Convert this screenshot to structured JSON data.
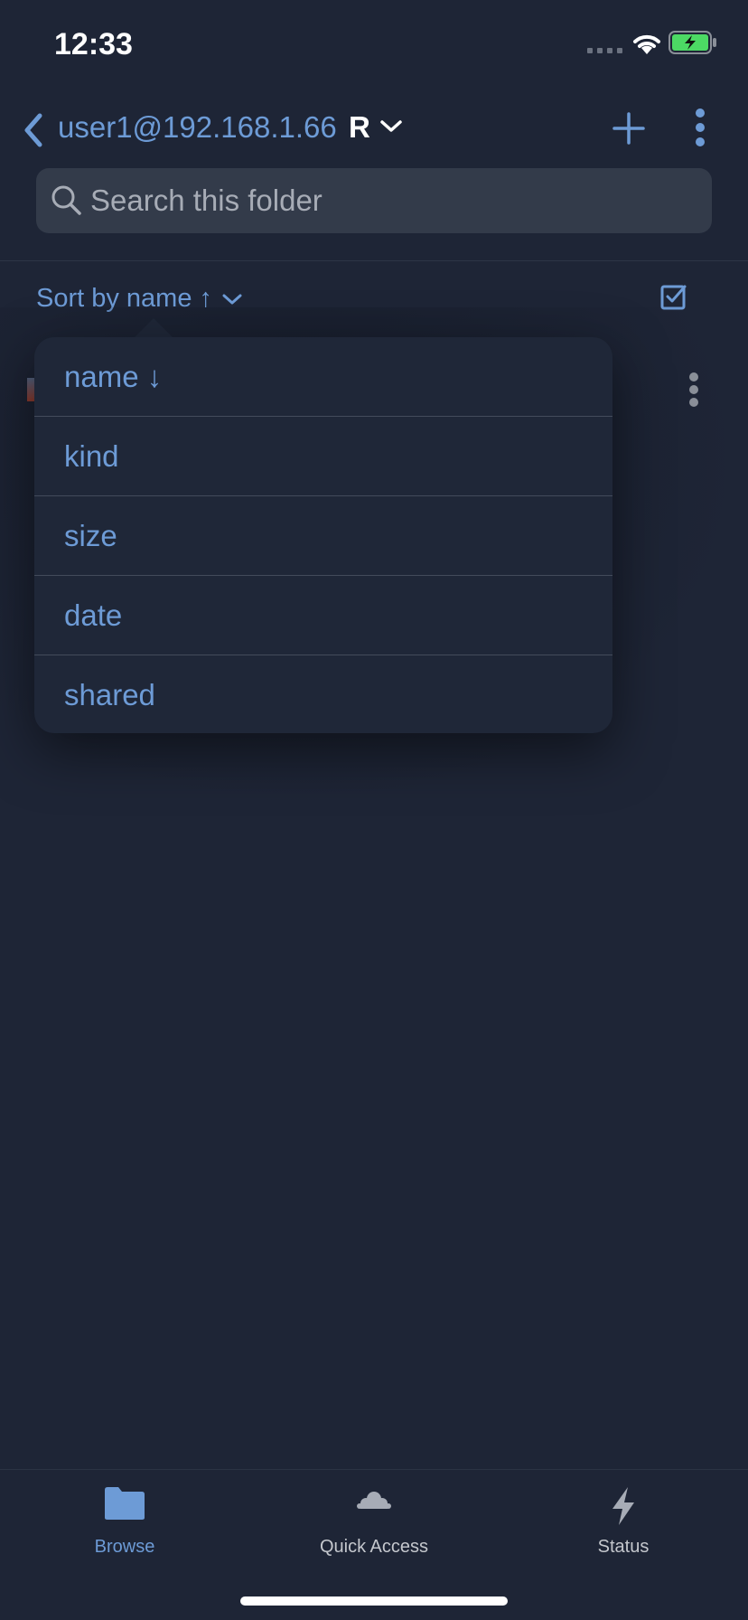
{
  "status_bar": {
    "time": "12:33"
  },
  "nav": {
    "title": "user1@192.168.1.66",
    "folder_label": "R"
  },
  "search": {
    "placeholder": "Search this folder"
  },
  "sort": {
    "label": "Sort by name ↑"
  },
  "sort_menu": {
    "options": [
      {
        "label": "name ↓"
      },
      {
        "label": "kind"
      },
      {
        "label": "size"
      },
      {
        "label": "date"
      },
      {
        "label": "shared"
      }
    ]
  },
  "tabs": [
    {
      "label": "Browse",
      "icon": "folder-icon",
      "active": true
    },
    {
      "label": "Quick Access",
      "icon": "cloud-icon",
      "active": false
    },
    {
      "label": "Status",
      "icon": "bolt-icon",
      "active": false
    }
  ],
  "colors": {
    "background": "#1e2536",
    "accent": "#6d9bd6",
    "popover": "#1f2738",
    "battery": "#4cd964"
  }
}
